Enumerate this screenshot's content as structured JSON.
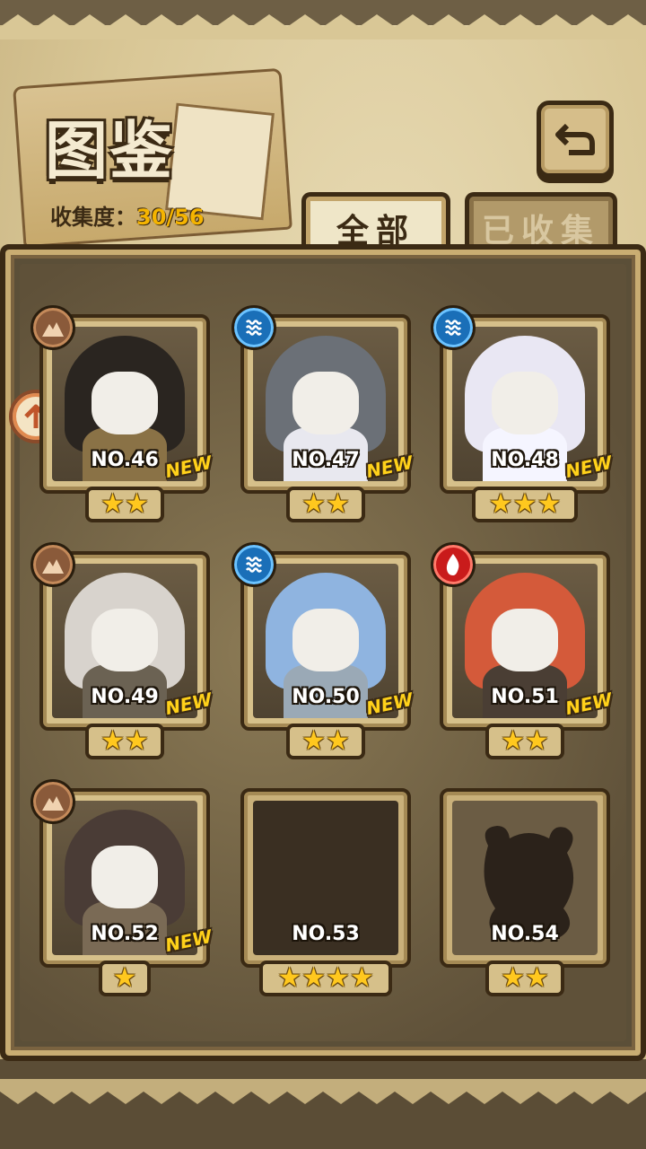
{
  "header": {
    "title": "图鉴",
    "collection_label": "收集度：",
    "collection_value": "30/56"
  },
  "tabs": [
    {
      "label": "全部",
      "active": true
    },
    {
      "label": "已收集",
      "active": false
    }
  ],
  "colors": {
    "accent": "#ffd11a",
    "earth": "#8a5a3a",
    "water": "#1a6fb8",
    "fire": "#c91b1b",
    "frame": "#3b2a14"
  },
  "cards": [
    {
      "number": "NO.46",
      "element": "earth",
      "stars": 2,
      "new": true,
      "new_label": "NEW",
      "locked": false
    },
    {
      "number": "NO.47",
      "element": "water",
      "stars": 2,
      "new": true,
      "new_label": "NEW",
      "locked": false
    },
    {
      "number": "NO.48",
      "element": "water",
      "stars": 3,
      "new": true,
      "new_label": "NEW",
      "locked": false
    },
    {
      "number": "NO.49",
      "element": "earth",
      "stars": 2,
      "new": true,
      "new_label": "NEW",
      "locked": false
    },
    {
      "number": "NO.50",
      "element": "water",
      "stars": 2,
      "new": true,
      "new_label": "NEW",
      "locked": false
    },
    {
      "number": "NO.51",
      "element": "fire",
      "stars": 2,
      "new": true,
      "new_label": "NEW",
      "locked": false
    },
    {
      "number": "NO.52",
      "element": "earth",
      "stars": 1,
      "new": true,
      "new_label": "NEW",
      "locked": false
    },
    {
      "number": "NO.53",
      "element": "",
      "stars": 4,
      "new": false,
      "new_label": "",
      "locked": true
    },
    {
      "number": "NO.54",
      "element": "",
      "stars": 2,
      "new": false,
      "new_label": "",
      "locked": true
    }
  ]
}
